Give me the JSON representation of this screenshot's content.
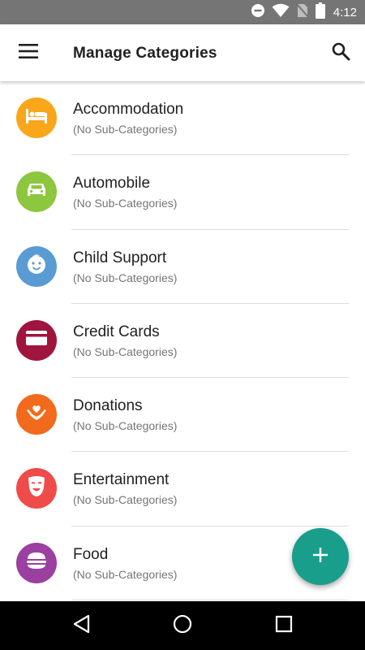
{
  "status_bar": {
    "time": "4:12",
    "icons": [
      "do-not-disturb-icon",
      "wifi-icon",
      "no-sim-icon",
      "battery-icon"
    ]
  },
  "app_bar": {
    "title": "Manage Categories",
    "menu_icon": "menu-icon",
    "search_icon": "search-icon"
  },
  "categories": [
    {
      "name": "Accommodation",
      "subtitle": "(No Sub-Categories)",
      "color": "#F9A61A",
      "icon": "bed-icon"
    },
    {
      "name": "Automobile",
      "subtitle": "(No Sub-Categories)",
      "color": "#8DC63F",
      "icon": "car-icon"
    },
    {
      "name": "Child Support",
      "subtitle": "(No Sub-Categories)",
      "color": "#5A9BD3",
      "icon": "child-face-icon"
    },
    {
      "name": "Credit Cards",
      "subtitle": "(No Sub-Categories)",
      "color": "#A0153E",
      "icon": "credit-card-icon"
    },
    {
      "name": "Donations",
      "subtitle": "(No Sub-Categories)",
      "color": "#F26A1B",
      "icon": "heart-hands-icon"
    },
    {
      "name": "Entertainment",
      "subtitle": "(No Sub-Categories)",
      "color": "#EF4B4B",
      "icon": "theater-mask-icon"
    },
    {
      "name": "Food",
      "subtitle": "(No Sub-Categories)",
      "color": "#9B3FA0",
      "icon": "burger-icon"
    }
  ],
  "fab": {
    "icon": "plus-icon",
    "color": "#1A9E8C"
  },
  "nav_bar": {
    "icons": [
      "back-icon",
      "home-icon",
      "recents-icon"
    ]
  }
}
